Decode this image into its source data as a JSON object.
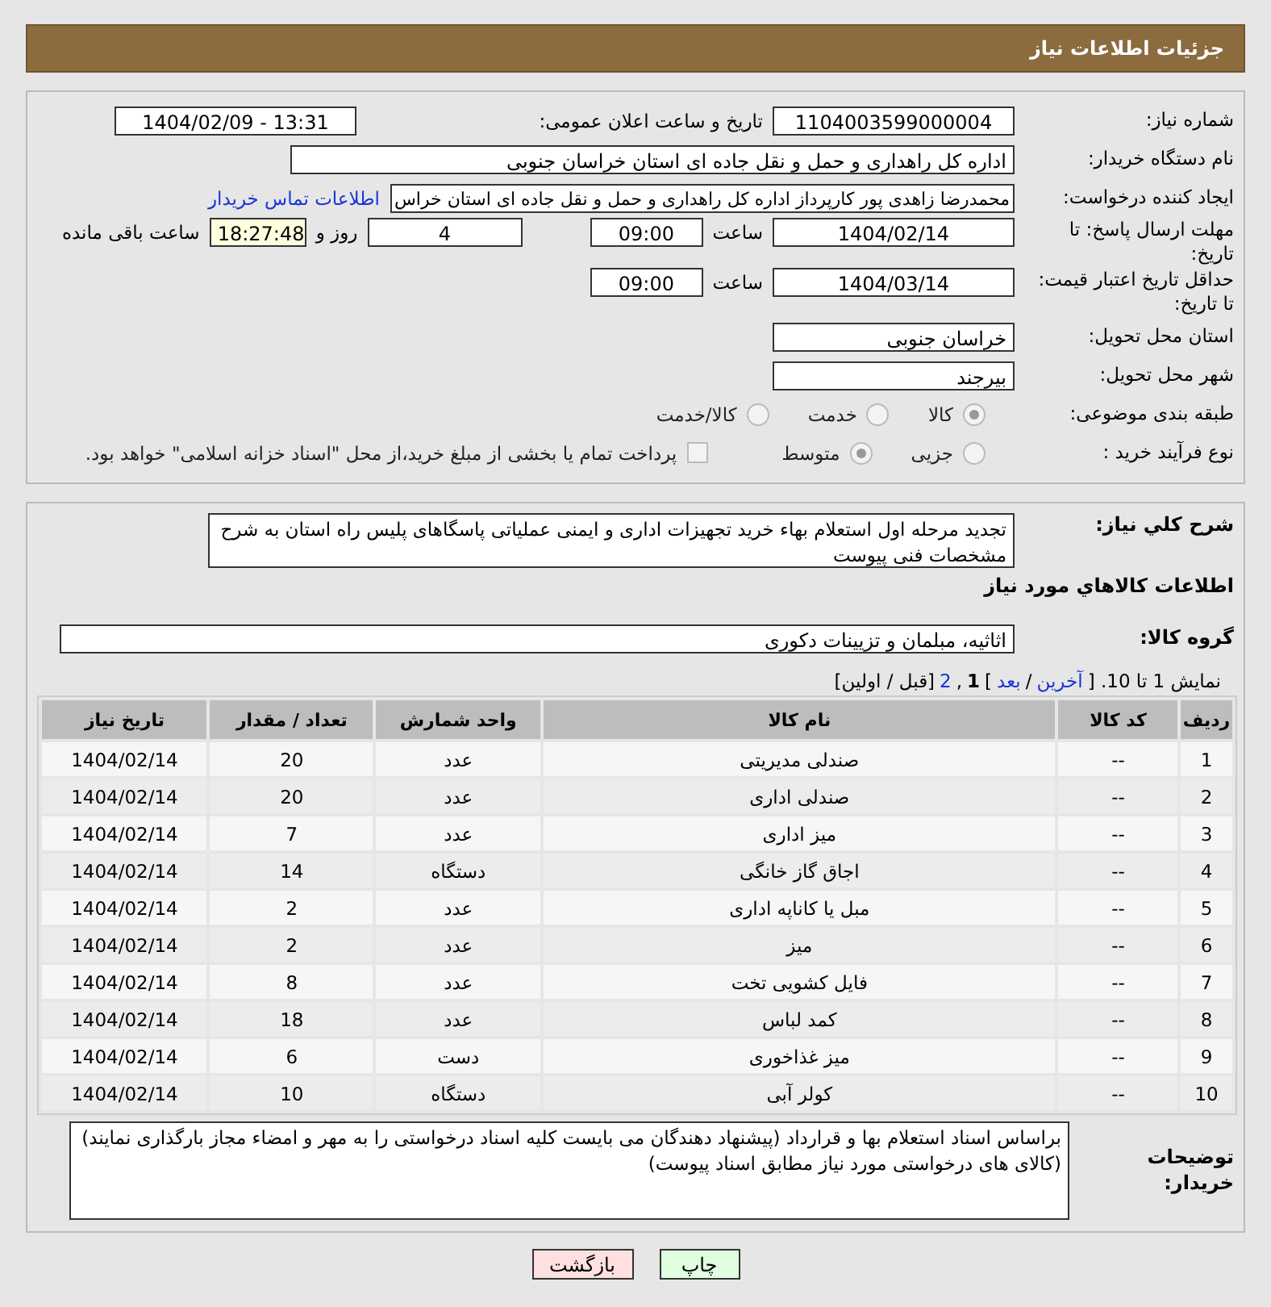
{
  "header": {
    "title": "جزئیات اطلاعات نیاز"
  },
  "details": {
    "need_number": {
      "label": "شماره نیاز:",
      "value": "1104003599000004"
    },
    "announce": {
      "label": "تاریخ و ساعت اعلان عمومی:",
      "value": "1404/02/09 - 13:31"
    },
    "buyer": {
      "label": "نام دستگاه خریدار:",
      "value": "اداره کل راهداری و حمل و نقل جاده ای استان خراسان جنوبی"
    },
    "creator": {
      "label": "ایجاد کننده درخواست:",
      "value": "محمدرضا زاهدی پور کارپرداز اداره کل راهداری و حمل و نقل جاده ای استان خراس",
      "link": "اطلاعات تماس خریدار"
    },
    "deadline": {
      "label": "مهلت ارسال پاسخ: تا تاریخ:",
      "date": "1404/02/14",
      "time_label": "ساعت",
      "time": "09:00",
      "days": "4",
      "days_label": "روز و",
      "remaining": "18:27:48",
      "remaining_label": "ساعت باقی مانده"
    },
    "validity": {
      "label": "حداقل تاریخ اعتبار قیمت: تا تاریخ:",
      "date": "1404/03/14",
      "time_label": "ساعت",
      "time": "09:00"
    },
    "province": {
      "label": "استان محل تحویل:",
      "value": "خراسان جنوبی"
    },
    "city": {
      "label": "شهر محل تحویل:",
      "value": "بیرجند"
    },
    "category": {
      "label": "طبقه بندی موضوعی:",
      "options": [
        {
          "label": "کالا",
          "selected": true
        },
        {
          "label": "خدمت",
          "selected": false
        },
        {
          "label": "کالا/خدمت",
          "selected": false
        }
      ]
    },
    "process": {
      "label": "نوع فرآیند خرید :",
      "options": [
        {
          "label": "جزیی",
          "selected": false
        },
        {
          "label": "متوسط",
          "selected": true
        }
      ],
      "treasury": {
        "label": "پرداخت تمام یا بخشی از مبلغ خرید،از محل \"اسناد خزانه اسلامی\" خواهد بود.",
        "checked": false
      }
    }
  },
  "summary": {
    "label": "شرح کلي نياز:",
    "value": "تجدید مرحله اول استعلام بهاء خرید تجهیزات اداری و ایمنی عملیاتی پاسگاهای پلیس راه استان به شرح مشخصات فنی پیوست"
  },
  "goods_heading": "اطلاعات كالاهاي مورد نياز",
  "goods_group": {
    "label": "گروه کالا:",
    "value": "اثاثیه، مبلمان و تزیینات دکوری"
  },
  "pagination": [
    {
      "kind": "text",
      "text": "نمایش 1 تا 10. ["
    },
    {
      "kind": "link",
      "text": "آخرین"
    },
    {
      "kind": "text",
      "text": "/"
    },
    {
      "kind": "link",
      "text": "بعد"
    },
    {
      "kind": "text",
      "text": "]"
    },
    {
      "kind": "link",
      "text": "2"
    },
    {
      "kind": "text",
      "text": ","
    },
    {
      "kind": "current",
      "text": "1"
    },
    {
      "kind": "text",
      "text": "[قبل / اولین]"
    }
  ],
  "table": {
    "columns": [
      "ردیف",
      "کد کالا",
      "نام کالا",
      "واحد شمارش",
      "تعداد / مقدار",
      "تاریخ نیاز"
    ],
    "rows": [
      [
        "1",
        "--",
        "صندلی مدیریتی",
        "عدد",
        "20",
        "1404/02/14"
      ],
      [
        "2",
        "--",
        "صندلی اداری",
        "عدد",
        "20",
        "1404/02/14"
      ],
      [
        "3",
        "--",
        "میز اداری",
        "عدد",
        "7",
        "1404/02/14"
      ],
      [
        "4",
        "--",
        "اجاق گاز خانگی",
        "دستگاه",
        "14",
        "1404/02/14"
      ],
      [
        "5",
        "--",
        "مبل یا کاناپه اداری",
        "عدد",
        "2",
        "1404/02/14"
      ],
      [
        "6",
        "--",
        "میز",
        "عدد",
        "2",
        "1404/02/14"
      ],
      [
        "7",
        "--",
        "فایل کشویی تخت",
        "عدد",
        "8",
        "1404/02/14"
      ],
      [
        "8",
        "--",
        "کمد لباس",
        "عدد",
        "18",
        "1404/02/14"
      ],
      [
        "9",
        "--",
        "میز غذاخوری",
        "دست",
        "6",
        "1404/02/14"
      ],
      [
        "10",
        "--",
        "کولر آبی",
        "دستگاه",
        "10",
        "1404/02/14"
      ]
    ]
  },
  "notes": {
    "label": "توضیحات خریدار:",
    "value": "براساس اسناد استعلام بها و قرارداد (پیشنهاد دهندگان می بایست کلیه اسناد درخواستی را به مهر و امضاء مجاز بارگذاری نمایند)(کالای های درخواستی مورد نیاز مطابق اسناد پیوست)"
  },
  "buttons": [
    {
      "kind": "print",
      "label": "چاپ"
    },
    {
      "kind": "back",
      "label": "بازگشت"
    }
  ]
}
